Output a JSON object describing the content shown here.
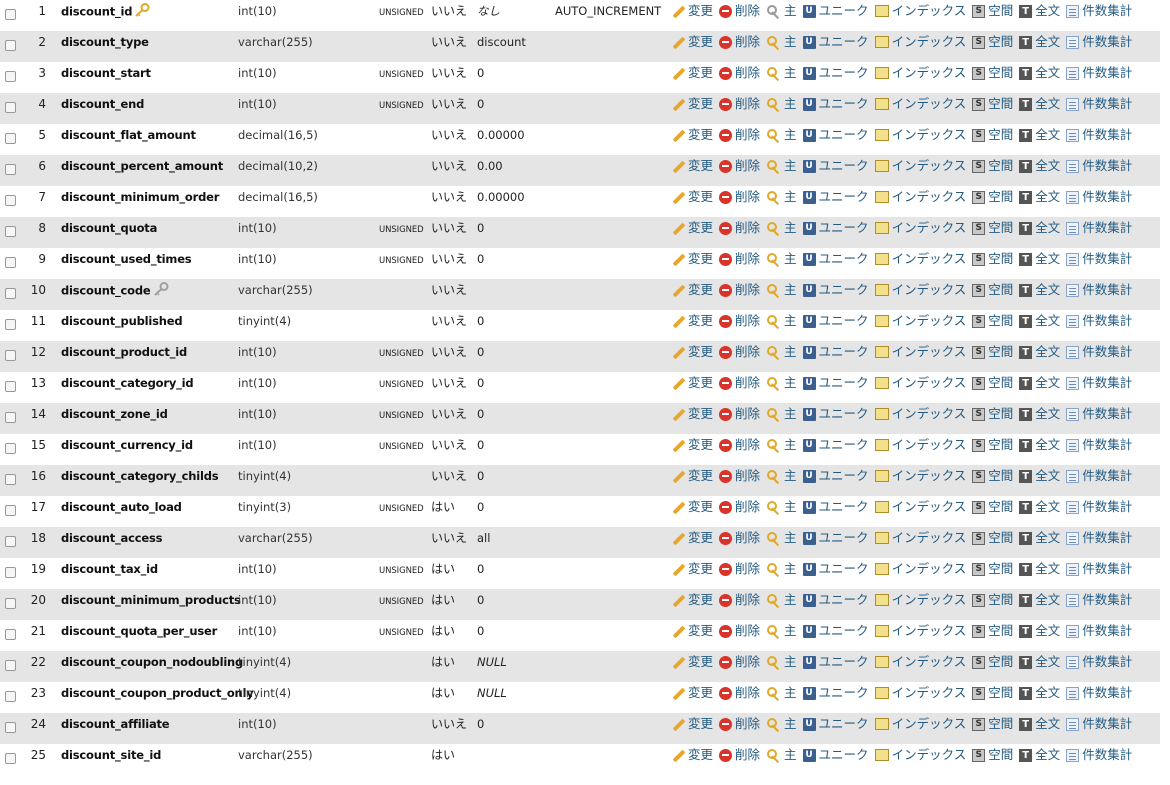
{
  "actions": {
    "edit": "変更",
    "drop": "削除",
    "primary": "主",
    "unique": "ユニーク",
    "index": "インデックス",
    "spatial": "空間",
    "fulltext": "全文",
    "count": "件数集計"
  },
  "icons": {
    "edit": "pencil-icon",
    "drop": "delete-icon",
    "primary": "key-icon",
    "unique": "unique-icon",
    "index": "index-icon",
    "spatial": "spatial-icon",
    "fulltext": "fulltext-icon",
    "count": "count-icon"
  },
  "colors": {
    "row_alt": "#e5e5e5",
    "link": "#235a81"
  },
  "rows": [
    {
      "num": "1",
      "name": "discount_id",
      "key": "primary",
      "type": "int(10)",
      "attr": "UNSIGNED",
      "null": "いいえ",
      "default": "なし",
      "default_italic": true,
      "extra": "AUTO_INCREMENT"
    },
    {
      "num": "2",
      "name": "discount_type",
      "key": "",
      "type": "varchar(255)",
      "attr": "",
      "null": "いいえ",
      "default": "discount",
      "default_italic": false,
      "extra": ""
    },
    {
      "num": "3",
      "name": "discount_start",
      "key": "",
      "type": "int(10)",
      "attr": "UNSIGNED",
      "null": "いいえ",
      "default": "0",
      "default_italic": false,
      "extra": ""
    },
    {
      "num": "4",
      "name": "discount_end",
      "key": "",
      "type": "int(10)",
      "attr": "UNSIGNED",
      "null": "いいえ",
      "default": "0",
      "default_italic": false,
      "extra": ""
    },
    {
      "num": "5",
      "name": "discount_flat_amount",
      "key": "",
      "type": "decimal(16,5)",
      "attr": "",
      "null": "いいえ",
      "default": "0.00000",
      "default_italic": false,
      "extra": ""
    },
    {
      "num": "6",
      "name": "discount_percent_amount",
      "key": "",
      "type": "decimal(10,2)",
      "attr": "",
      "null": "いいえ",
      "default": "0.00",
      "default_italic": false,
      "extra": ""
    },
    {
      "num": "7",
      "name": "discount_minimum_order",
      "key": "",
      "type": "decimal(16,5)",
      "attr": "",
      "null": "いいえ",
      "default": "0.00000",
      "default_italic": false,
      "extra": ""
    },
    {
      "num": "8",
      "name": "discount_quota",
      "key": "",
      "type": "int(10)",
      "attr": "UNSIGNED",
      "null": "いいえ",
      "default": "0",
      "default_italic": false,
      "extra": ""
    },
    {
      "num": "9",
      "name": "discount_used_times",
      "key": "",
      "type": "int(10)",
      "attr": "UNSIGNED",
      "null": "いいえ",
      "default": "0",
      "default_italic": false,
      "extra": ""
    },
    {
      "num": "10",
      "name": "discount_code",
      "key": "index",
      "type": "varchar(255)",
      "attr": "",
      "null": "いいえ",
      "default": "",
      "default_italic": false,
      "extra": ""
    },
    {
      "num": "11",
      "name": "discount_published",
      "key": "",
      "type": "tinyint(4)",
      "attr": "",
      "null": "いいえ",
      "default": "0",
      "default_italic": false,
      "extra": ""
    },
    {
      "num": "12",
      "name": "discount_product_id",
      "key": "",
      "type": "int(10)",
      "attr": "UNSIGNED",
      "null": "いいえ",
      "default": "0",
      "default_italic": false,
      "extra": ""
    },
    {
      "num": "13",
      "name": "discount_category_id",
      "key": "",
      "type": "int(10)",
      "attr": "UNSIGNED",
      "null": "いいえ",
      "default": "0",
      "default_italic": false,
      "extra": ""
    },
    {
      "num": "14",
      "name": "discount_zone_id",
      "key": "",
      "type": "int(10)",
      "attr": "UNSIGNED",
      "null": "いいえ",
      "default": "0",
      "default_italic": false,
      "extra": ""
    },
    {
      "num": "15",
      "name": "discount_currency_id",
      "key": "",
      "type": "int(10)",
      "attr": "UNSIGNED",
      "null": "いいえ",
      "default": "0",
      "default_italic": false,
      "extra": ""
    },
    {
      "num": "16",
      "name": "discount_category_childs",
      "key": "",
      "type": "tinyint(4)",
      "attr": "",
      "null": "いいえ",
      "default": "0",
      "default_italic": false,
      "extra": ""
    },
    {
      "num": "17",
      "name": "discount_auto_load",
      "key": "",
      "type": "tinyint(3)",
      "attr": "UNSIGNED",
      "null": "はい",
      "default": "0",
      "default_italic": false,
      "extra": ""
    },
    {
      "num": "18",
      "name": "discount_access",
      "key": "",
      "type": "varchar(255)",
      "attr": "",
      "null": "いいえ",
      "default": "all",
      "default_italic": false,
      "extra": ""
    },
    {
      "num": "19",
      "name": "discount_tax_id",
      "key": "",
      "type": "int(10)",
      "attr": "UNSIGNED",
      "null": "はい",
      "default": "0",
      "default_italic": false,
      "extra": ""
    },
    {
      "num": "20",
      "name": "discount_minimum_products",
      "key": "",
      "type": "int(10)",
      "attr": "UNSIGNED",
      "null": "はい",
      "default": "0",
      "default_italic": false,
      "extra": ""
    },
    {
      "num": "21",
      "name": "discount_quota_per_user",
      "key": "",
      "type": "int(10)",
      "attr": "UNSIGNED",
      "null": "はい",
      "default": "0",
      "default_italic": false,
      "extra": ""
    },
    {
      "num": "22",
      "name": "discount_coupon_nodoubling",
      "key": "",
      "type": "tinyint(4)",
      "attr": "",
      "null": "はい",
      "default": "NULL",
      "default_italic": true,
      "extra": ""
    },
    {
      "num": "23",
      "name": "discount_coupon_product_only",
      "key": "",
      "type": "tinyint(4)",
      "attr": "",
      "null": "はい",
      "default": "NULL",
      "default_italic": true,
      "extra": ""
    },
    {
      "num": "24",
      "name": "discount_affiliate",
      "key": "",
      "type": "int(10)",
      "attr": "",
      "null": "いいえ",
      "default": "0",
      "default_italic": false,
      "extra": ""
    },
    {
      "num": "25",
      "name": "discount_site_id",
      "key": "",
      "type": "varchar(255)",
      "attr": "",
      "null": "はい",
      "default": "",
      "default_italic": false,
      "extra": ""
    }
  ]
}
